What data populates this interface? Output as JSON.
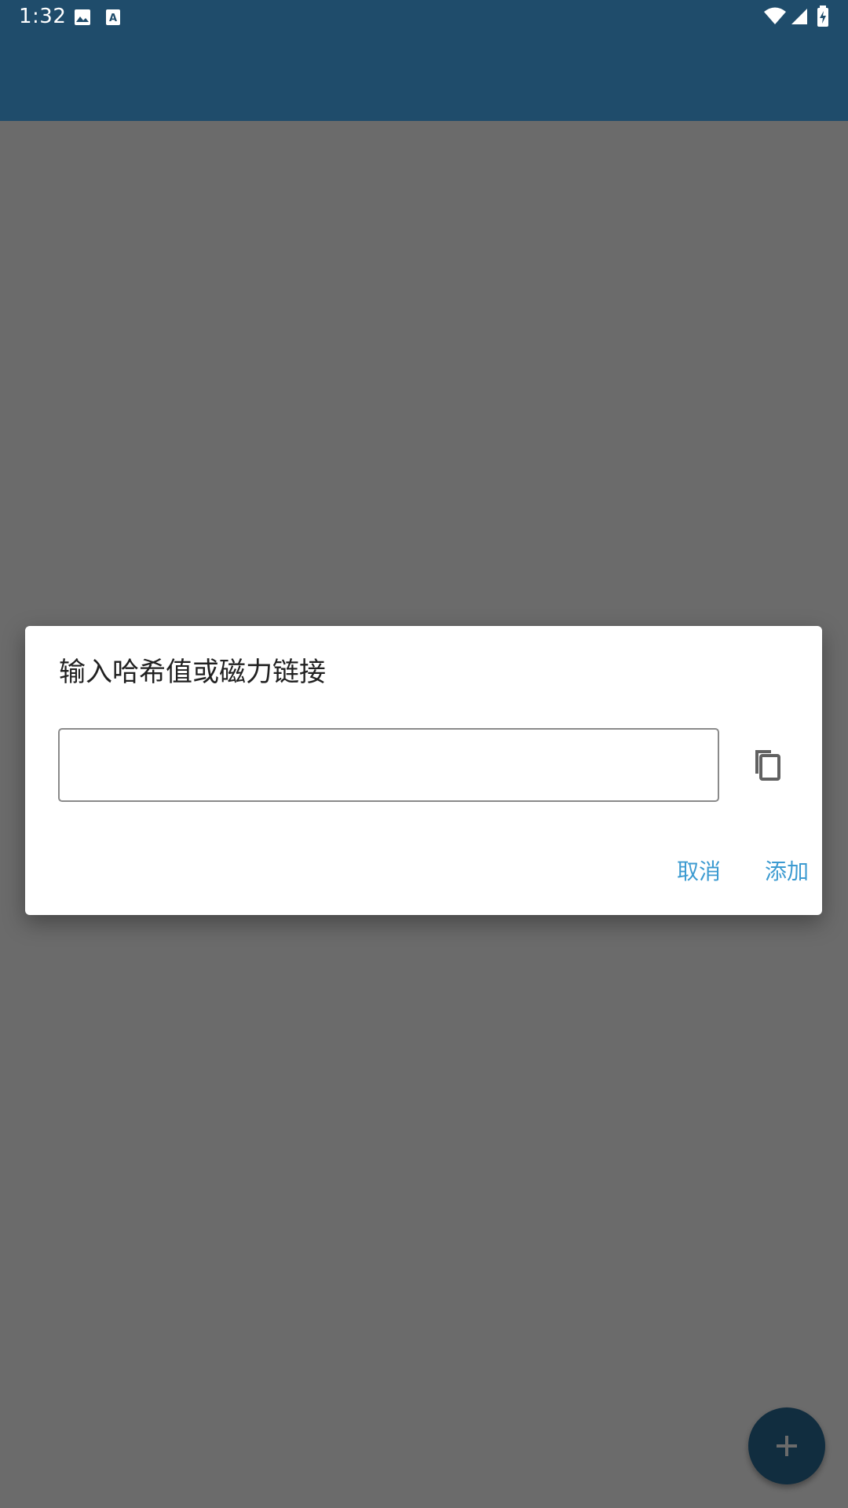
{
  "status_bar": {
    "time": "1:32",
    "icons": [
      "image-icon",
      "font-icon",
      "wifi-icon",
      "cell-signal-icon",
      "battery-charging-icon"
    ]
  },
  "colors": {
    "app_bar": "#1f4c6b",
    "accent": "#3d9bd1",
    "fab": "#2a6b96"
  },
  "dialog": {
    "title": "输入哈希值或磁力链接",
    "input_value": "",
    "paste_icon": "content-copy-icon",
    "cancel_label": "取消",
    "add_label": "添加"
  },
  "fab": {
    "icon": "plus-icon"
  }
}
